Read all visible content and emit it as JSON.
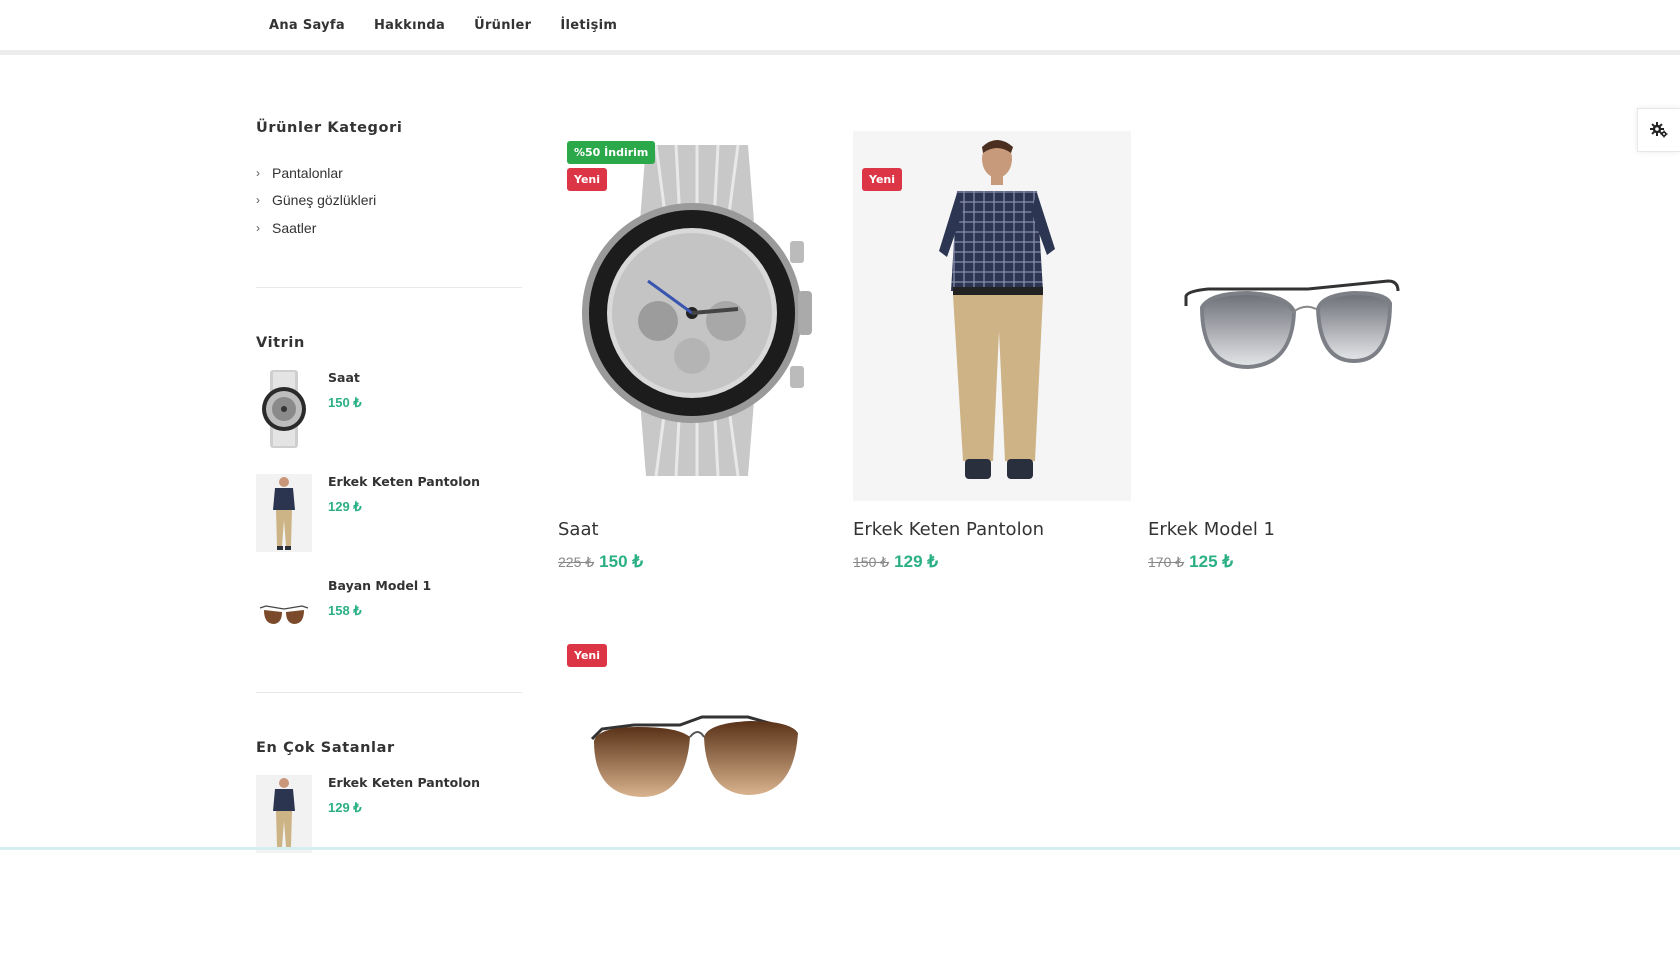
{
  "nav": {
    "items": [
      "Ana Sayfa",
      "Hakkında",
      "Ürünler",
      "İletişim"
    ]
  },
  "sidebar": {
    "categories_title": "Ürünler Kategori",
    "categories": [
      "Pantalonlar",
      "Güneş gözlükleri",
      "Saatler"
    ],
    "showcase_title": "Vitrin",
    "showcase": [
      {
        "name": "Saat",
        "price": "150 ₺",
        "icon": "watch-thumb"
      },
      {
        "name": "Erkek Keten Pantolon",
        "price": "129 ₺",
        "icon": "man-thumb"
      },
      {
        "name": "Bayan Model 1",
        "price": "158 ₺",
        "icon": "sunglasses-brown-thumb"
      }
    ],
    "bestsellers_title": "En Çok Satanlar",
    "bestsellers": [
      {
        "name": "Erkek Keten Pantolon",
        "price": "129 ₺",
        "icon": "man-thumb"
      }
    ]
  },
  "products": [
    {
      "name": "Saat",
      "old_price": "225 ₺",
      "price": "150 ₺",
      "badges": [
        "%50 İndirim",
        "Yeni"
      ],
      "image": "watch"
    },
    {
      "name": "Erkek Keten Pantolon",
      "old_price": "150 ₺",
      "price": "129 ₺",
      "badges": [
        "Yeni"
      ],
      "image": "man"
    },
    {
      "name": "Erkek Model 1",
      "old_price": "170 ₺",
      "price": "125 ₺",
      "badges": [],
      "image": "sunglasses-grey"
    },
    {
      "name": "",
      "old_price": "",
      "price": "",
      "badges": [
        "Yeni"
      ],
      "image": "sunglasses-brown"
    }
  ],
  "colors": {
    "price": "#2bb085",
    "badge_sale": "#2ba84a",
    "badge_new": "#dc3545"
  },
  "settings": {
    "icon": "gear-settings-icon"
  }
}
